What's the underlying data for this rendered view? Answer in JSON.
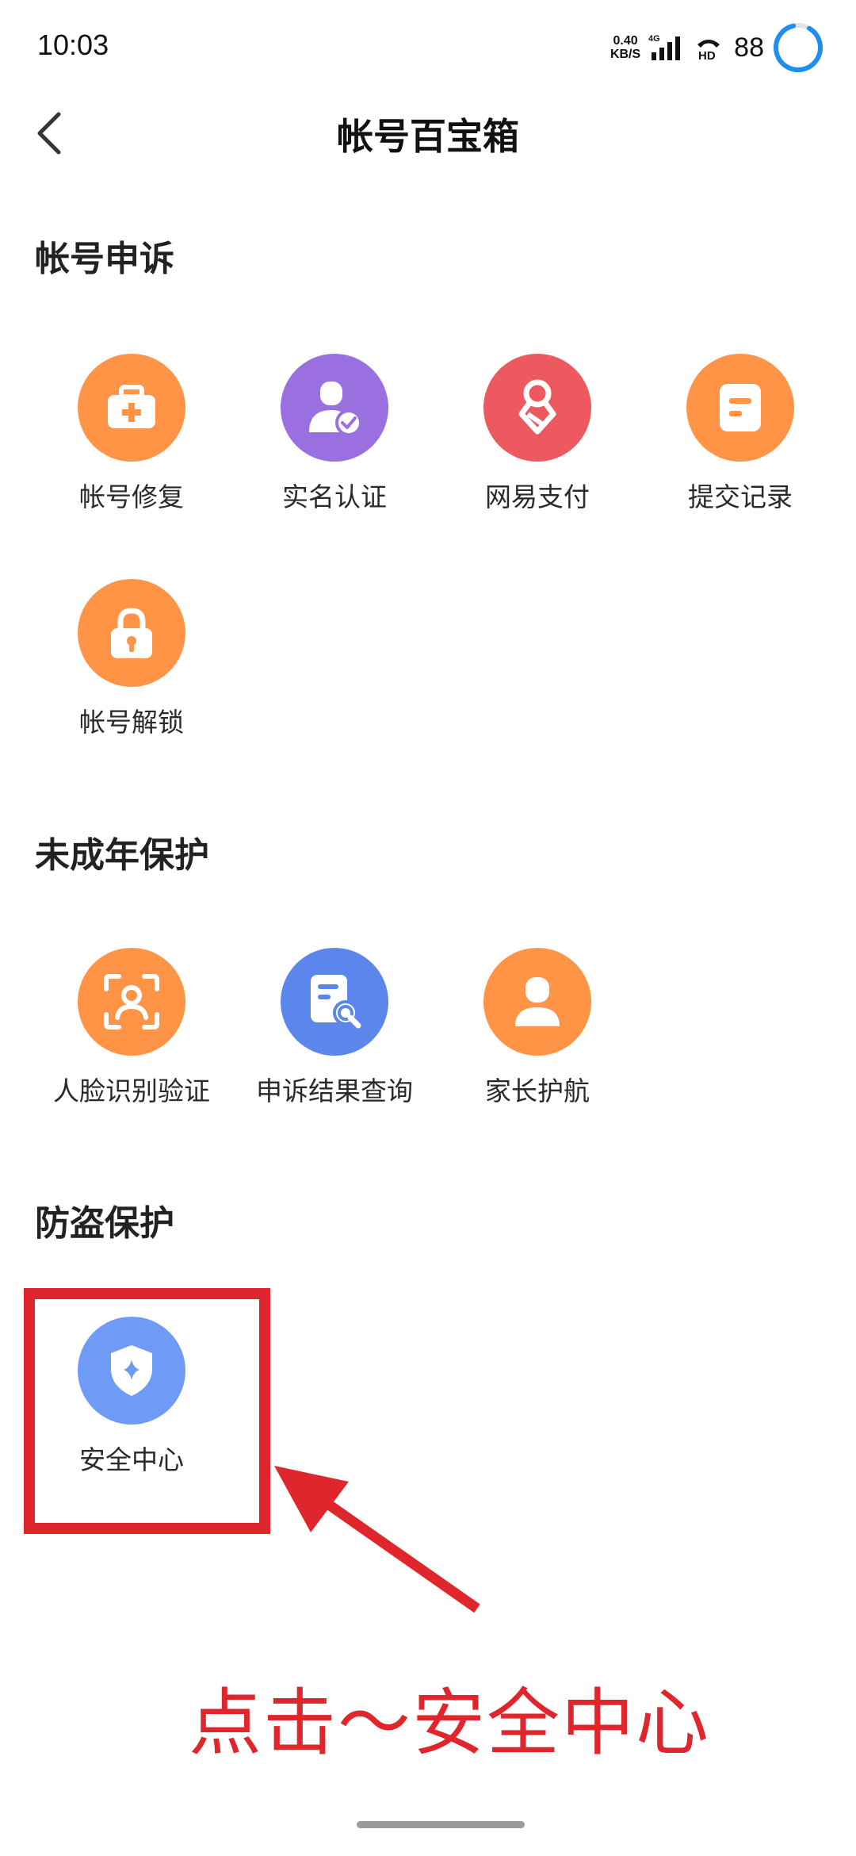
{
  "status_bar": {
    "time": "10:03",
    "net_speed_value": "0.40",
    "net_speed_unit": "KB/S",
    "network_type": "4G",
    "hd_label": "HD",
    "battery": "88"
  },
  "header": {
    "title": "帐号百宝箱"
  },
  "sections": [
    {
      "title": "帐号申诉",
      "items": [
        {
          "label": "帐号修复",
          "icon": "first-aid-kit-icon",
          "color": "#ff9447"
        },
        {
          "label": "实名认证",
          "icon": "user-verified-icon",
          "color": "#9a6fe0"
        },
        {
          "label": "网易支付",
          "icon": "netease-pay-icon",
          "color": "#ec5a5f"
        },
        {
          "label": "提交记录",
          "icon": "document-icon",
          "color": "#ff9447"
        },
        {
          "label": "帐号解锁",
          "icon": "lock-icon",
          "color": "#ff9447"
        }
      ]
    },
    {
      "title": "未成年保护",
      "items": [
        {
          "label": "人脸识别验证",
          "icon": "face-scan-icon",
          "color": "#ff9447"
        },
        {
          "label": "申诉结果查询",
          "icon": "document-search-icon",
          "color": "#5b86eb"
        },
        {
          "label": "家长护航",
          "icon": "user-icon",
          "color": "#ff9447"
        }
      ]
    },
    {
      "title": "防盗保护",
      "items": [
        {
          "label": "安全中心",
          "icon": "shield-icon",
          "color": "#6f9bf7"
        }
      ]
    }
  ],
  "annotation": {
    "text": "点击～安全中心",
    "color": "#e0262d"
  }
}
